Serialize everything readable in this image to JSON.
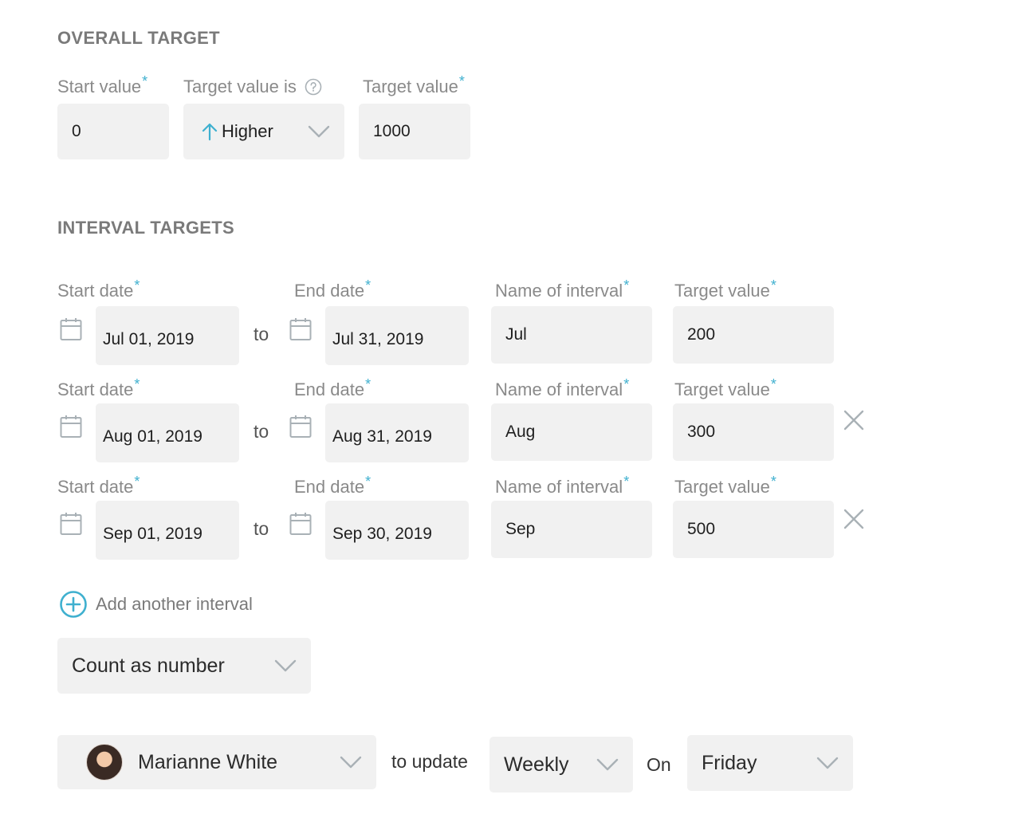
{
  "overall": {
    "title": "OVERALL TARGET",
    "start_value_label": "Start value",
    "direction_label": "Target value is",
    "target_value_label": "Target value",
    "start_value": "0",
    "direction_value": "Higher",
    "target_value": "1000"
  },
  "interval": {
    "title": "INTERVAL TARGETS",
    "labels": {
      "start_date": "Start date",
      "end_date": "End date",
      "name": "Name of interval",
      "target": "Target value",
      "to": "to"
    },
    "rows": [
      {
        "start": "Jul 01, 2019",
        "end": "Jul 31, 2019",
        "name": "Jul",
        "target": "200"
      },
      {
        "start": "Aug 01, 2019",
        "end": "Aug 31, 2019",
        "name": "Aug",
        "target": "300"
      },
      {
        "start": "Sep 01, 2019",
        "end": "Sep 30, 2019",
        "name": "Sep",
        "target": "500"
      }
    ],
    "add_label": "Add another interval"
  },
  "count_mode": "Count as number",
  "update": {
    "owner": "Marianne White",
    "to_update": "to update",
    "frequency": "Weekly",
    "on": "On",
    "day": "Friday"
  },
  "colors": {
    "accent": "#3fb0cf",
    "field_bg": "#f1f1f1",
    "icon_gray": "#a9b1b6"
  },
  "icons": [
    "help-icon",
    "arrow-up-icon",
    "chevron-down-icon",
    "calendar-icon",
    "close-icon",
    "plus-circle-icon",
    "avatar"
  ]
}
